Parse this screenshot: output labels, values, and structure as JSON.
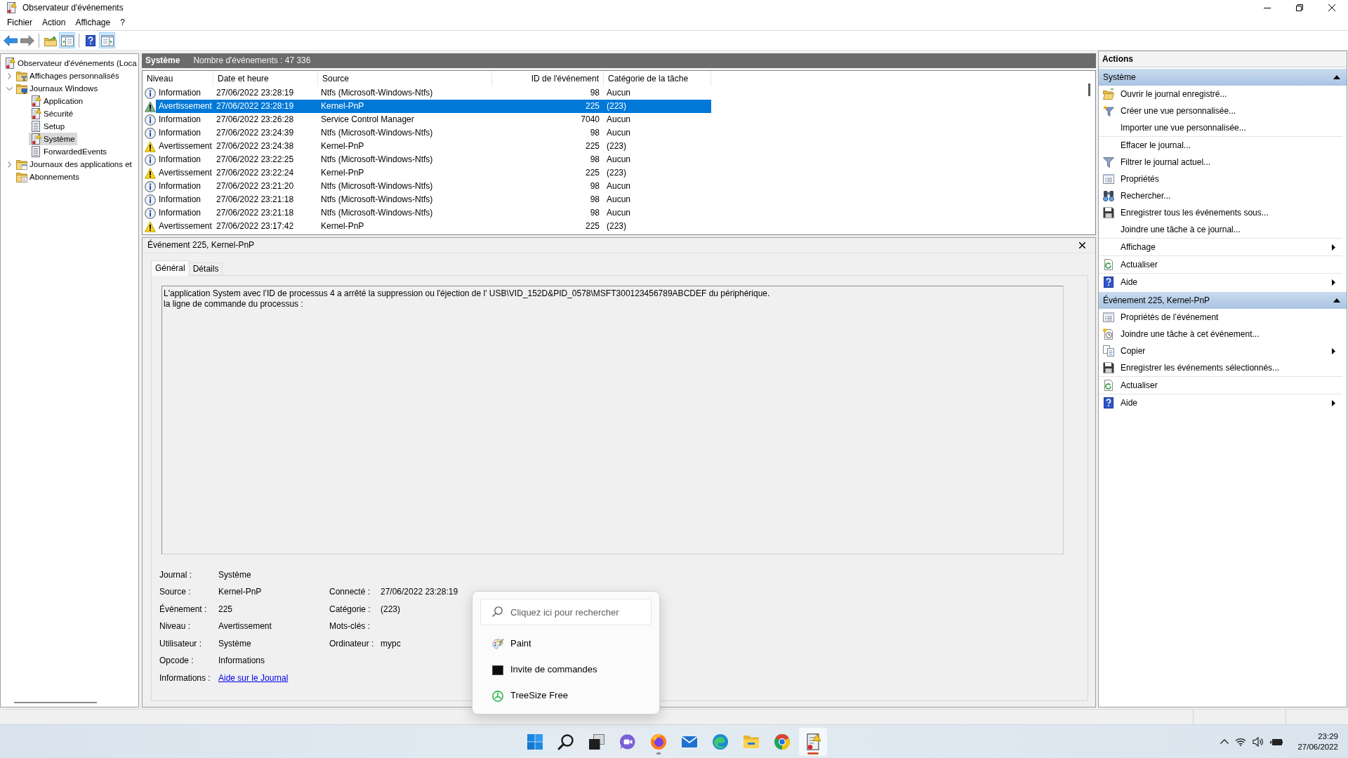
{
  "window": {
    "title": "Observateur d'événements"
  },
  "menu": [
    {
      "label": "Fichier"
    },
    {
      "label": "Action"
    },
    {
      "label": "Affichage"
    },
    {
      "label": "?"
    }
  ],
  "toolbar": [
    {
      "kind": "back",
      "disabled": false,
      "pressed": false
    },
    {
      "kind": "forward",
      "disabled": true,
      "pressed": false
    },
    {
      "kind": "separator"
    },
    {
      "kind": "up",
      "disabled": false,
      "pressed": false
    },
    {
      "kind": "console-tree",
      "disabled": false,
      "pressed": true
    },
    {
      "kind": "separator"
    },
    {
      "kind": "help",
      "disabled": false,
      "pressed": false
    },
    {
      "kind": "action-pane",
      "disabled": false,
      "pressed": true
    }
  ],
  "tree": [
    {
      "label": "Observateur d'événements (Loca",
      "kind": "root",
      "selected": false,
      "children": [
        {
          "label": "Affichages personnalisés",
          "kind": "custom-views",
          "selected": false,
          "expanded": false
        },
        {
          "label": "Journaux Windows",
          "kind": "logs-folder",
          "selected": false,
          "expanded": true,
          "children": [
            {
              "label": "Application",
              "kind": "log",
              "selected": false
            },
            {
              "label": "Sécurité",
              "kind": "log",
              "selected": false
            },
            {
              "label": "Setup",
              "kind": "plain-log",
              "selected": false
            },
            {
              "label": "Système",
              "kind": "log",
              "selected": true
            },
            {
              "label": "ForwardedEvents",
              "kind": "plain-log",
              "selected": false
            }
          ]
        },
        {
          "label": "Journaux des applications et",
          "kind": "apps-folder",
          "selected": false,
          "expanded": false
        },
        {
          "label": "Abonnements",
          "kind": "subscriptions",
          "selected": false
        }
      ]
    }
  ],
  "list_header": {
    "title": "Système",
    "count": "Nombre d'événements : 47 336"
  },
  "events": {
    "columns": [
      "Niveau",
      "Date et heure",
      "Source",
      "ID de l'événement",
      "Catégorie de la tâche"
    ],
    "rows": [
      {
        "kind": "information",
        "selected": false,
        "cells": [
          "Information",
          "27/06/2022 23:28:19",
          "Ntfs (Microsoft-Windows-Ntfs)",
          "98",
          "Aucun"
        ]
      },
      {
        "kind": "warning",
        "selected": true,
        "cells": [
          "Avertissement",
          "27/06/2022 23:28:19",
          "Kernel-PnP",
          "225",
          "(223)"
        ]
      },
      {
        "kind": "information",
        "selected": false,
        "cells": [
          "Information",
          "27/06/2022 23:26:28",
          "Service Control Manager",
          "7040",
          "Aucun"
        ]
      },
      {
        "kind": "information",
        "selected": false,
        "cells": [
          "Information",
          "27/06/2022 23:24:39",
          "Ntfs (Microsoft-Windows-Ntfs)",
          "98",
          "Aucun"
        ]
      },
      {
        "kind": "warning",
        "selected": false,
        "cells": [
          "Avertissement",
          "27/06/2022 23:24:38",
          "Kernel-PnP",
          "225",
          "(223)"
        ]
      },
      {
        "kind": "information",
        "selected": false,
        "cells": [
          "Information",
          "27/06/2022 23:22:25",
          "Ntfs (Microsoft-Windows-Ntfs)",
          "98",
          "Aucun"
        ]
      },
      {
        "kind": "warning",
        "selected": false,
        "cells": [
          "Avertissement",
          "27/06/2022 23:22:24",
          "Kernel-PnP",
          "225",
          "(223)"
        ]
      },
      {
        "kind": "information",
        "selected": false,
        "cells": [
          "Information",
          "27/06/2022 23:21:20",
          "Ntfs (Microsoft-Windows-Ntfs)",
          "98",
          "Aucun"
        ]
      },
      {
        "kind": "information",
        "selected": false,
        "cells": [
          "Information",
          "27/06/2022 23:21:18",
          "Ntfs (Microsoft-Windows-Ntfs)",
          "98",
          "Aucun"
        ]
      },
      {
        "kind": "information",
        "selected": false,
        "cells": [
          "Information",
          "27/06/2022 23:21:18",
          "Ntfs (Microsoft-Windows-Ntfs)",
          "98",
          "Aucun"
        ]
      },
      {
        "kind": "warning",
        "selected": false,
        "cells": [
          "Avertissement",
          "27/06/2022 23:17:42",
          "Kernel-PnP",
          "225",
          "(223)"
        ]
      }
    ]
  },
  "detail": {
    "title": "Événement 225, Kernel-PnP",
    "tabs": [
      {
        "label": "Général",
        "selected": true
      },
      {
        "label": "Détails",
        "selected": false
      }
    ],
    "message": [
      "L'application System avec l’ID de processus 4 a arrêté la suppression ou l'éjection de l' USB\\VID_152D&PID_0578\\MSFT300123456789ABCDEF du périphérique.",
      "la ligne de commande du processus :"
    ],
    "fields": [
      {
        "left": {
          "label": "Journal :",
          "value": "Système"
        }
      },
      {
        "left": {
          "label": "Source :",
          "value": "Kernel-PnP"
        },
        "right": {
          "label": "Connecté :",
          "value": "27/06/2022 23:28:19"
        }
      },
      {
        "left": {
          "label": "Événement :",
          "value": "225"
        },
        "right": {
          "label": "Catégorie :",
          "value": "(223)"
        }
      },
      {
        "left": {
          "label": "Niveau :",
          "value": "Avertissement"
        },
        "right": {
          "label": "Mots-clés :"
        }
      },
      {
        "left": {
          "label": "Utilisateur :",
          "value": "Système"
        },
        "right": {
          "label": "Ordinateur :",
          "value": "mypc"
        }
      },
      {
        "left": {
          "label": "Opcode :",
          "value": "Informations"
        }
      },
      {
        "left": {
          "label": "Informations :",
          "link": "Aide sur le Journal"
        }
      }
    ]
  },
  "actions": {
    "title": "Actions",
    "sections": [
      {
        "title": "Système",
        "expanded": true,
        "groups": [
          [
            {
              "kind": "open-folder",
              "label": "Ouvrir le journal enregistré...",
              "submenu": false
            },
            {
              "kind": "funnel-star",
              "label": "Créer une vue personnalisée...",
              "submenu": false
            },
            {
              "kind": "plain",
              "label": "Importer une vue personnalisée...",
              "submenu": false
            }
          ],
          [
            {
              "kind": "plain",
              "label": "Effacer le journal...",
              "submenu": false
            },
            {
              "kind": "funnel",
              "label": "Filtrer le journal actuel...",
              "submenu": false
            },
            {
              "kind": "properties",
              "label": "Propriétés",
              "submenu": false
            },
            {
              "kind": "binoculars",
              "label": "Rechercher...",
              "submenu": false
            },
            {
              "kind": "floppy",
              "label": "Enregistrer tous les événements sous...",
              "submenu": false
            },
            {
              "kind": "plain",
              "label": "Joindre une tâche à ce journal...",
              "submenu": false
            }
          ],
          [
            {
              "kind": "plain",
              "label": "Affichage",
              "submenu": true
            }
          ],
          [
            {
              "kind": "refresh",
              "label": "Actualiser",
              "submenu": false
            }
          ],
          [
            {
              "kind": "help",
              "label": "Aide",
              "submenu": true
            }
          ]
        ]
      },
      {
        "title": "Événement 225, Kernel-PnP",
        "expanded": true,
        "groups": [
          [
            {
              "kind": "properties",
              "label": "Propriétés de l’événement",
              "submenu": false
            },
            {
              "kind": "clock-task",
              "label": "Joindre une tâche à cet événement...",
              "submenu": false
            },
            {
              "kind": "copy",
              "label": "Copier",
              "submenu": true
            },
            {
              "kind": "floppy",
              "label": "Enregistrer les événements sélectionnés...",
              "submenu": false
            }
          ],
          [
            {
              "kind": "refresh",
              "label": "Actualiser",
              "submenu": false
            }
          ],
          [
            {
              "kind": "help",
              "label": "Aide",
              "submenu": true
            }
          ]
        ]
      }
    ]
  },
  "search_popup": {
    "placeholder": "Cliquez ici pour rechercher",
    "results": [
      {
        "kind": "paint",
        "label": "Paint"
      },
      {
        "kind": "terminal",
        "label": "Invite de commandes"
      },
      {
        "kind": "treesize",
        "label": "TreeSize Free"
      }
    ]
  },
  "taskbar": {
    "apps": [
      {
        "kind": "start",
        "running": false,
        "active": false
      },
      {
        "kind": "search",
        "running": false,
        "active": false
      },
      {
        "kind": "task-view",
        "running": false,
        "active": false
      },
      {
        "kind": "chat",
        "running": false,
        "active": false
      },
      {
        "kind": "fox-browser",
        "running": true,
        "active": false
      },
      {
        "kind": "mail",
        "running": false,
        "active": false
      },
      {
        "kind": "wave-browser",
        "running": false,
        "active": false
      },
      {
        "kind": "explorer",
        "running": false,
        "active": false
      },
      {
        "kind": "wheel-browser",
        "running": false,
        "active": false
      },
      {
        "kind": "event-viewer",
        "running": true,
        "active": true
      }
    ],
    "clock": {
      "time": "23:29",
      "date": "27/06/2022"
    }
  }
}
